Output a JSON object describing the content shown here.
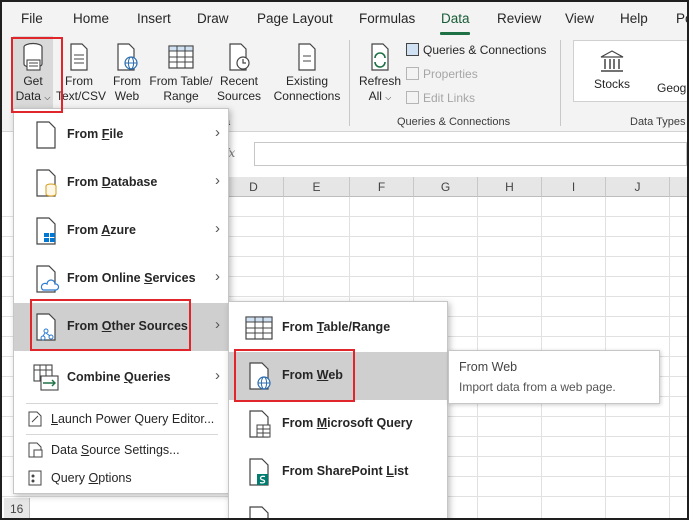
{
  "tabs": [
    {
      "label": "File"
    },
    {
      "label": "Home"
    },
    {
      "label": "Insert"
    },
    {
      "label": "Draw"
    },
    {
      "label": "Page Layout"
    },
    {
      "label": "Formulas"
    },
    {
      "label": "Data"
    },
    {
      "label": "Review"
    },
    {
      "label": "View"
    },
    {
      "label": "Help"
    },
    {
      "label": "Po"
    }
  ],
  "ribbon": {
    "get_data": {
      "line1": "Get",
      "line2": "Data"
    },
    "from_text": {
      "line1": "From",
      "line2": "Text/CSV"
    },
    "from_web": {
      "line1": "From",
      "line2": "Web"
    },
    "from_table": {
      "line1": "From Table/",
      "line2": "Range"
    },
    "recent": {
      "line1": "Recent",
      "line2": "Sources"
    },
    "existing": {
      "line1": "Existing",
      "line2": "Connections"
    },
    "refresh": {
      "line1": "Refresh",
      "line2": "All"
    },
    "queries_connections": "Queries & Connections",
    "properties": "Properties",
    "edit_links": "Edit Links",
    "group_queries": "Queries & Connections",
    "group_get_fragment": "a",
    "stocks": "Stocks",
    "geography": "Geog",
    "group_datatypes": "Data Types"
  },
  "formula": {
    "fx": "fx"
  },
  "columns": [
    "D",
    "E",
    "F",
    "G",
    "H",
    "I",
    "J"
  ],
  "row_number": "16",
  "menu": {
    "items": [
      {
        "pre": "From ",
        "u": "F",
        "post": "ile"
      },
      {
        "pre": "From ",
        "u": "D",
        "post": "atabase"
      },
      {
        "pre": "From ",
        "u": "A",
        "post": "zure"
      },
      {
        "pre": "From Online ",
        "u": "S",
        "post": "ervices"
      },
      {
        "pre": "From ",
        "u": "O",
        "post": "ther Sources"
      },
      {
        "pre": "Combine ",
        "u": "Q",
        "post": "ueries"
      }
    ],
    "launch": {
      "pre": "",
      "u": "L",
      "post": "aunch Power Query Editor..."
    },
    "settings": {
      "pre": "Data ",
      "u": "S",
      "post": "ource Settings..."
    },
    "options": {
      "pre": "Query ",
      "u": "O",
      "post": "ptions"
    }
  },
  "submenu": {
    "items": [
      {
        "pre": "From ",
        "u": "T",
        "post": "able/Range"
      },
      {
        "pre": "From ",
        "u": "W",
        "post": "eb"
      },
      {
        "pre": "From ",
        "u": "M",
        "post": "icrosoft Query"
      },
      {
        "pre": "From SharePoint ",
        "u": "L",
        "post": "ist"
      }
    ]
  },
  "tooltip": {
    "title": "From Web",
    "desc": "Import data from a web page."
  },
  "colors": {
    "accent": "#1e7145",
    "highlight_box": "#e0262a",
    "hover": "#cfcfcf"
  }
}
